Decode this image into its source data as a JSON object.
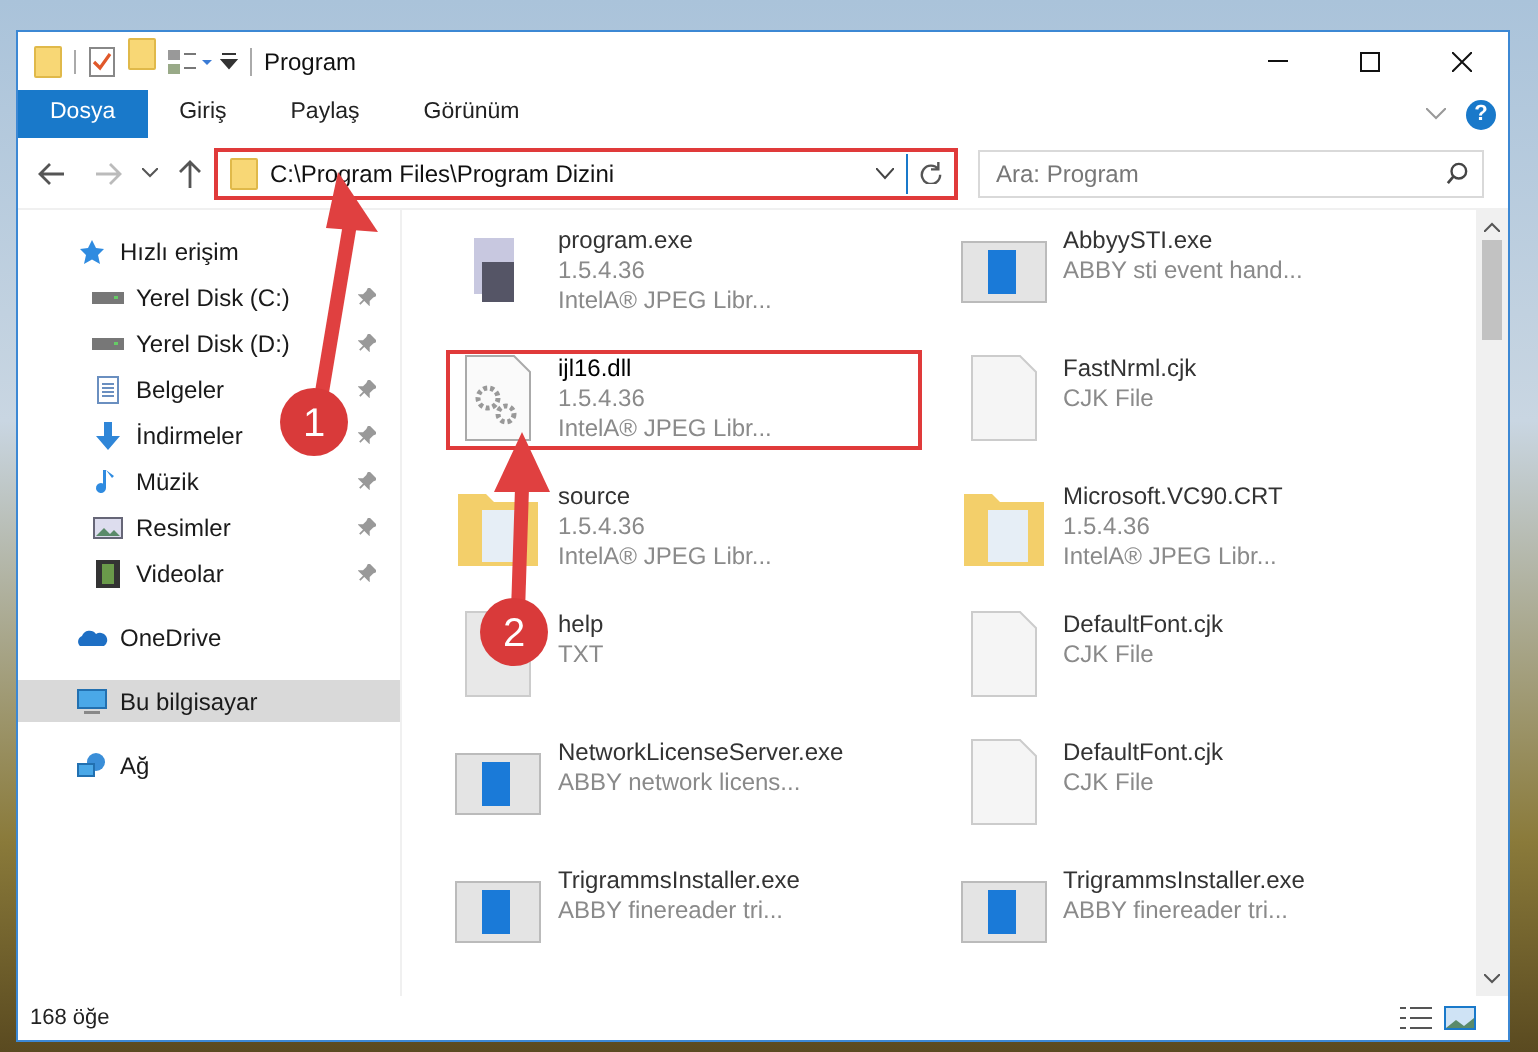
{
  "window": {
    "title": "Program"
  },
  "ribbon_tabs": [
    {
      "label": "Dosya",
      "selected": true
    },
    {
      "label": "Giriş",
      "selected": false
    },
    {
      "label": "Paylaş",
      "selected": false
    },
    {
      "label": "Görünüm",
      "selected": false
    }
  ],
  "address": {
    "path": "C:\\Program Files\\Program Dizini",
    "highlighted": true
  },
  "search": {
    "placeholder": "Ara: Program"
  },
  "sidebar": {
    "items": [
      {
        "label": "Hızlı erişim",
        "kind": "star",
        "pinned": false,
        "selected": false,
        "children": [
          {
            "label": "Yerel Disk (C:)",
            "kind": "drive",
            "pinned": true,
            "selected": false
          },
          {
            "label": "Yerel Disk (D:)",
            "kind": "drive",
            "pinned": true,
            "selected": false
          },
          {
            "label": "Belgeler",
            "kind": "document",
            "pinned": true,
            "selected": false
          },
          {
            "label": "İndirmeler",
            "kind": "download",
            "pinned": true,
            "selected": false
          },
          {
            "label": "Müzik",
            "kind": "music",
            "pinned": true,
            "selected": false
          },
          {
            "label": "Resimler",
            "kind": "picture",
            "pinned": true,
            "selected": false
          },
          {
            "label": "Videolar",
            "kind": "video",
            "pinned": true,
            "selected": false
          }
        ]
      },
      {
        "label": "OneDrive",
        "kind": "cloud",
        "pinned": false,
        "selected": false
      },
      {
        "label": "Bu bilgisayar",
        "kind": "computer",
        "pinned": false,
        "selected": true
      },
      {
        "label": "Ağ",
        "kind": "network",
        "pinned": false,
        "selected": false
      }
    ]
  },
  "files": [
    {
      "name": "program.exe",
      "lines": [
        "1.5.4.36",
        "IntelA® JPEG Libr..."
      ],
      "kind": "program",
      "highlighted": false
    },
    {
      "name": "AbbyySTI.exe",
      "lines": [
        "ABBY sti event hand..."
      ],
      "kind": "app",
      "highlighted": false
    },
    {
      "name": "ijl16.dll",
      "lines": [
        "1.5.4.36",
        "IntelA® JPEG Libr..."
      ],
      "kind": "dll",
      "highlighted": true
    },
    {
      "name": "FastNrml.cjk",
      "lines": [
        "CJK File"
      ],
      "kind": "file",
      "highlighted": false
    },
    {
      "name": "source",
      "lines": [
        "1.5.4.36",
        "IntelA® JPEG Libr..."
      ],
      "kind": "folder",
      "highlighted": false
    },
    {
      "name": "Microsoft.VC90.CRT",
      "lines": [
        "1.5.4.36",
        "IntelA® JPEG Libr..."
      ],
      "kind": "folder",
      "highlighted": false
    },
    {
      "name": "help",
      "lines": [
        "TXT"
      ],
      "kind": "text",
      "highlighted": false
    },
    {
      "name": "DefaultFont.cjk",
      "lines": [
        "CJK File"
      ],
      "kind": "file",
      "highlighted": false
    },
    {
      "name": "NetworkLicenseServer.exe",
      "lines": [
        "ABBY network licens..."
      ],
      "kind": "app",
      "highlighted": false
    },
    {
      "name": "DefaultFont.cjk",
      "lines": [
        "CJK File"
      ],
      "kind": "file",
      "highlighted": false
    },
    {
      "name": "TrigrammsInstaller.exe",
      "lines": [
        "ABBY finereader tri..."
      ],
      "kind": "app",
      "highlighted": false
    },
    {
      "name": "TrigrammsInstaller.exe",
      "lines": [
        "ABBY finereader tri..."
      ],
      "kind": "app",
      "highlighted": false
    }
  ],
  "callouts": [
    "1",
    "2"
  ],
  "help_button": "?",
  "status_bar": {
    "count": "168 öğe"
  }
}
